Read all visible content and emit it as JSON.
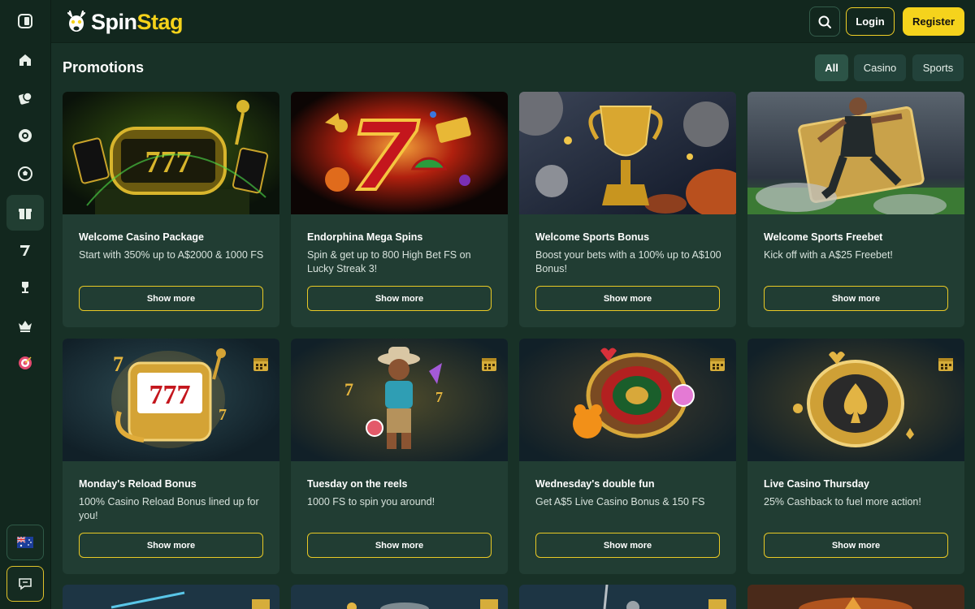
{
  "header": {
    "logo_text_a": "Spin",
    "logo_text_b": "Stag",
    "login_label": "Login",
    "register_label": "Register"
  },
  "page": {
    "title": "Promotions",
    "filters": [
      {
        "label": "All",
        "active": true
      },
      {
        "label": "Casino",
        "active": false
      },
      {
        "label": "Sports",
        "active": false
      }
    ]
  },
  "promotions": [
    {
      "title": "Welcome Casino Package",
      "desc": "Start with 350% up to A$2000 & 1000 FS",
      "button": "Show more",
      "image": "golden-777-slot-machine"
    },
    {
      "title": "Endorphina Mega Spins",
      "desc": "Spin & get up to 800 High Bet FS on Lucky Streak 3!",
      "button": "Show more",
      "image": "fiery-lucky-seven"
    },
    {
      "title": "Welcome Sports Bonus",
      "desc": "Boost your bets with a 100% up to A$100 Bonus!",
      "button": "Show more",
      "image": "golden-trophy-balls"
    },
    {
      "title": "Welcome Sports Freebet",
      "desc": "Kick off with a A$25 Freebet!",
      "button": "Show more",
      "image": "soccer-player-ticket"
    },
    {
      "title": "Monday's Reload Bonus",
      "desc": "100% Casino Reload Bonus lined up for you!",
      "button": "Show more",
      "image": "slot-machine-777"
    },
    {
      "title": "Tuesday on the reels",
      "desc": "1000 FS to spin you around!",
      "button": "Show more",
      "image": "cowboy-character"
    },
    {
      "title": "Wednesday's double fun",
      "desc": "Get A$5 Live Casino Bonus & 150 FS",
      "button": "Show more",
      "image": "roulette-gummy-bear"
    },
    {
      "title": "Live Casino Thursday",
      "desc": "25% Cashback to fuel more action!",
      "button": "Show more",
      "image": "golden-spade-chip"
    }
  ],
  "sidebar": {
    "icons": [
      "sidebar-toggle-icon",
      "home-icon",
      "casino-chip-icon",
      "live-casino-icon",
      "sports-icon",
      "promotions-gift-icon",
      "lucky-seven-icon",
      "trophy-icon",
      "vip-crown-icon",
      "target-icon",
      "australia-flag-icon",
      "chat-icon"
    ]
  },
  "colors": {
    "background": "#183127",
    "card": "#213d33",
    "accent": "#f5d31c"
  }
}
